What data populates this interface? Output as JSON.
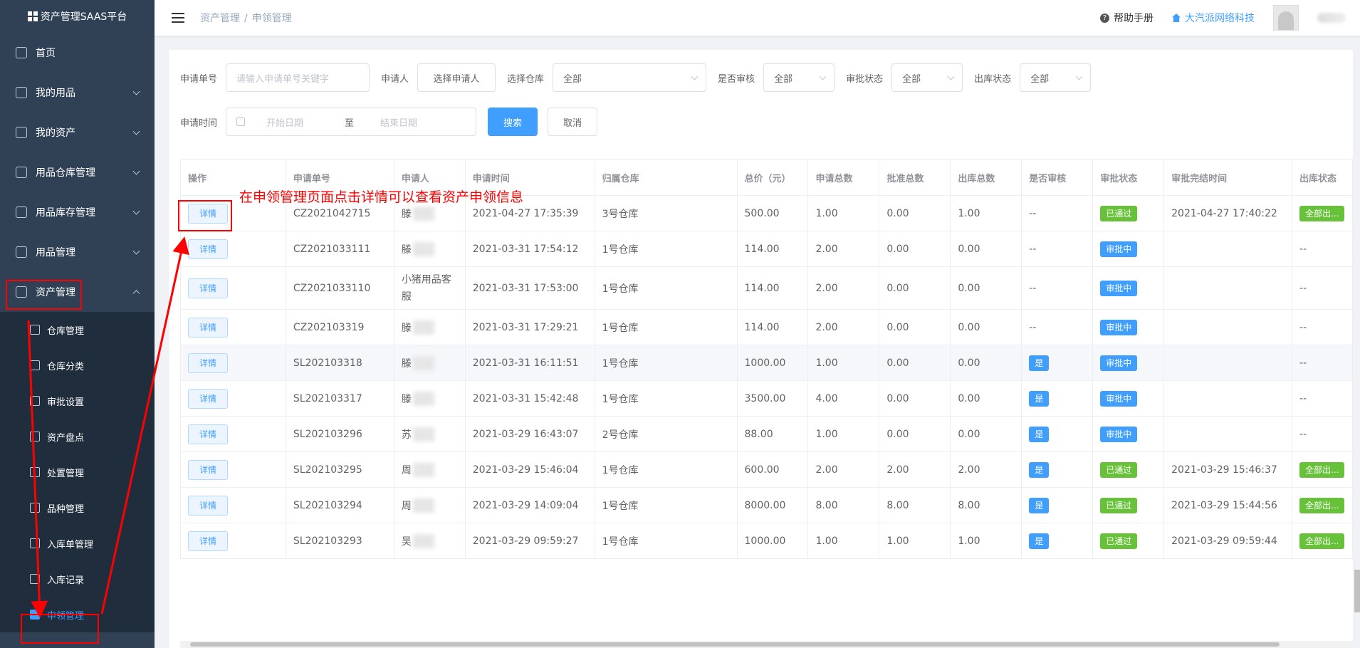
{
  "app": {
    "logo_text": "资产管理SAAS平台"
  },
  "sidebar": {
    "items": [
      {
        "label": "首页",
        "icon": "home-icon",
        "has_children": false
      },
      {
        "label": "我的用品",
        "icon": "bag-icon",
        "has_children": true
      },
      {
        "label": "我的资产",
        "icon": "asset-icon",
        "has_children": true
      },
      {
        "label": "用品仓库管理",
        "icon": "database-icon",
        "has_children": true
      },
      {
        "label": "用品库存管理",
        "icon": "box-icon",
        "has_children": true
      },
      {
        "label": "用品管理",
        "icon": "inbox-icon",
        "has_children": true
      },
      {
        "label": "资产管理",
        "icon": "gear-icon",
        "has_children": true,
        "expanded": true
      }
    ],
    "sub_items": [
      {
        "label": "仓库管理",
        "icon": "database-icon"
      },
      {
        "label": "仓库分类",
        "icon": "list-icon"
      },
      {
        "label": "审批设置",
        "icon": "user-icon"
      },
      {
        "label": "资产盘点",
        "icon": "clipboard-icon"
      },
      {
        "label": "处置管理",
        "icon": "gear-icon"
      },
      {
        "label": "品种管理",
        "icon": "user-icon"
      },
      {
        "label": "入库单管理",
        "icon": "doc-icon"
      },
      {
        "label": "入库记录",
        "icon": "doc-icon"
      },
      {
        "label": "申领管理",
        "icon": "clipboard-icon",
        "active": true
      }
    ]
  },
  "header": {
    "breadcrumb": [
      "资产管理",
      "申领管理"
    ],
    "breadcrumb_sep": "/",
    "help_label": "帮助手册",
    "help_icon": "?",
    "company_label": "大汽派网络科技"
  },
  "filters": {
    "app_no_label": "申请单号",
    "app_no_placeholder": "请输入申请单号关键字",
    "applicant_label": "申请人",
    "applicant_button": "选择申请人",
    "warehouse_label": "选择仓库",
    "warehouse_value": "全部",
    "need_review_label": "是否审核",
    "need_review_value": "全部",
    "approval_status_label": "审批状态",
    "approval_status_value": "全部",
    "outbound_status_label": "出库状态",
    "outbound_status_value": "全部",
    "time_label": "申请时间",
    "start_date_placeholder": "开始日期",
    "date_sep": "至",
    "end_date_placeholder": "结束日期",
    "search_button": "搜索",
    "cancel_button": "取消"
  },
  "table": {
    "columns": [
      "操作",
      "申请单号",
      "申请人",
      "申请时间",
      "归属仓库",
      "总价（元）",
      "申请总数",
      "批准总数",
      "出库总数",
      "是否审核",
      "审批状态",
      "审批完结时间",
      "出库状态"
    ],
    "detail_label": "详情",
    "rows": [
      {
        "no": "CZ2021042715",
        "applicant": "滕",
        "blur": true,
        "time": "2021-04-27 17:35:39",
        "warehouse": "3号仓库",
        "total": "500.00",
        "req": "1.00",
        "appr": "0.00",
        "out": "1.00",
        "review": "--",
        "status": "已通过",
        "status_color": "green",
        "done": "2021-04-27 17:40:22",
        "out_status": "全部出...",
        "out_tag": true
      },
      {
        "no": "CZ2021033111",
        "applicant": "滕",
        "blur": true,
        "time": "2021-03-31 17:54:12",
        "warehouse": "1号仓库",
        "total": "114.00",
        "req": "2.00",
        "appr": "0.00",
        "out": "0.00",
        "review": "--",
        "status": "审批中",
        "status_color": "blue",
        "done": "",
        "out_status": "--",
        "out_tag": false
      },
      {
        "no": "CZ2021033110",
        "applicant": "小猪用品客服",
        "blur": false,
        "wrap": true,
        "time": "2021-03-31 17:53:00",
        "warehouse": "1号仓库",
        "total": "114.00",
        "req": "2.00",
        "appr": "0.00",
        "out": "0.00",
        "review": "--",
        "status": "审批中",
        "status_color": "blue",
        "done": "",
        "out_status": "--",
        "out_tag": false
      },
      {
        "no": "CZ202103319",
        "applicant": "滕",
        "blur": true,
        "time": "2021-03-31 17:29:21",
        "warehouse": "1号仓库",
        "total": "114.00",
        "req": "2.00",
        "appr": "0.00",
        "out": "0.00",
        "review": "--",
        "status": "审批中",
        "status_color": "blue",
        "done": "",
        "out_status": "--",
        "out_tag": false
      },
      {
        "no": "SL202103318",
        "applicant": "滕",
        "blur": true,
        "time": "2021-03-31 16:11:51",
        "warehouse": "1号仓库",
        "total": "1000.00",
        "req": "1.00",
        "appr": "0.00",
        "out": "0.00",
        "review": "是",
        "status": "审批中",
        "status_color": "blue",
        "done": "",
        "out_status": "--",
        "out_tag": false,
        "hover": true
      },
      {
        "no": "SL202103317",
        "applicant": "滕",
        "blur": true,
        "time": "2021-03-31 15:42:48",
        "warehouse": "1号仓库",
        "total": "3500.00",
        "req": "4.00",
        "appr": "0.00",
        "out": "0.00",
        "review": "是",
        "status": "审批中",
        "status_color": "blue",
        "done": "",
        "out_status": "--",
        "out_tag": false
      },
      {
        "no": "SL202103296",
        "applicant": "苏",
        "blur": true,
        "time": "2021-03-29 16:43:07",
        "warehouse": "2号仓库",
        "total": "88.00",
        "req": "1.00",
        "appr": "0.00",
        "out": "0.00",
        "review": "是",
        "status": "审批中",
        "status_color": "blue",
        "done": "",
        "out_status": "--",
        "out_tag": false
      },
      {
        "no": "SL202103295",
        "applicant": "周",
        "blur": true,
        "time": "2021-03-29 15:46:04",
        "warehouse": "1号仓库",
        "total": "600.00",
        "req": "2.00",
        "appr": "2.00",
        "out": "2.00",
        "review": "是",
        "status": "已通过",
        "status_color": "green",
        "done": "2021-03-29 15:46:37",
        "out_status": "全部出...",
        "out_tag": true
      },
      {
        "no": "SL202103294",
        "applicant": "周",
        "blur": true,
        "time": "2021-03-29 14:09:04",
        "warehouse": "1号仓库",
        "total": "8000.00",
        "req": "8.00",
        "appr": "8.00",
        "out": "8.00",
        "review": "是",
        "status": "已通过",
        "status_color": "green",
        "done": "2021-03-29 15:44:56",
        "out_status": "全部出...",
        "out_tag": true
      },
      {
        "no": "SL202103293",
        "applicant": "吴",
        "blur": true,
        "time": "2021-03-29 09:59:27",
        "warehouse": "1号仓库",
        "total": "1000.00",
        "req": "1.00",
        "appr": "1.00",
        "out": "1.00",
        "review": "是",
        "status": "已通过",
        "status_color": "green",
        "done": "2021-03-29 09:59:44",
        "out_status": "全部出...",
        "out_tag": true
      }
    ]
  },
  "annotation": {
    "text": "在申领管理页面点击详情可以查看资产申领信息",
    "color": "#ff0000"
  },
  "colors": {
    "sidebar_bg": "#304156",
    "primary": "#409eff",
    "success": "#67c23a"
  }
}
